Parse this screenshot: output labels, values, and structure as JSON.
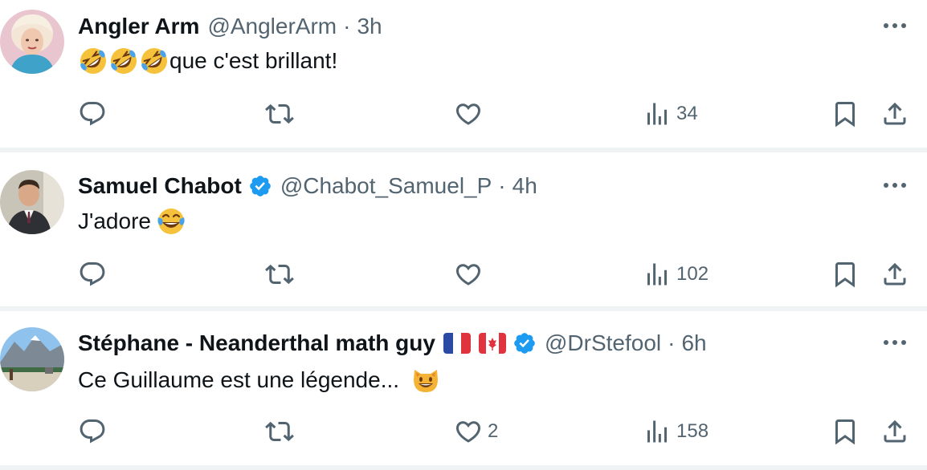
{
  "tweets": [
    {
      "name": "Angler Arm",
      "handle": "@AnglerArm",
      "separator": "·",
      "time": "3h",
      "verified": false,
      "text": "que c'est brillant!",
      "emojis_before": [
        "rolling-on-floor-laughing",
        "rolling-on-floor-laughing",
        "rolling-on-floor-laughing"
      ],
      "replies": "",
      "retweets": "",
      "likes": "",
      "views": "34"
    },
    {
      "name": "Samuel Chabot",
      "handle": "@Chabot_Samuel_P",
      "separator": "·",
      "time": "4h",
      "verified": true,
      "text": "J'adore",
      "emojis_after": [
        "face-with-tears-of-joy"
      ],
      "replies": "",
      "retweets": "",
      "likes": "",
      "views": "102"
    },
    {
      "name": "Stéphane - Neanderthal math guy",
      "handle": "@DrStefool",
      "separator": "·",
      "time": "6h",
      "verified": true,
      "flags": [
        "france-flag",
        "canada-flag"
      ],
      "text": "Ce Guillaume est une légende...",
      "emojis_after": [
        "grinning-cat"
      ],
      "replies": "",
      "retweets": "",
      "likes": "2",
      "views": "158"
    }
  ],
  "icons": {
    "reply": "reply-icon",
    "retweet": "retweet-icon",
    "like": "heart-icon",
    "views": "views-icon",
    "bookmark": "bookmark-icon",
    "share": "share-icon",
    "more": "more-icon",
    "verified": "verified-badge-icon"
  },
  "colors": {
    "text": "#0f1419",
    "secondary": "#536471",
    "divider": "#eff3f4",
    "verified": "#1d9bf0"
  }
}
